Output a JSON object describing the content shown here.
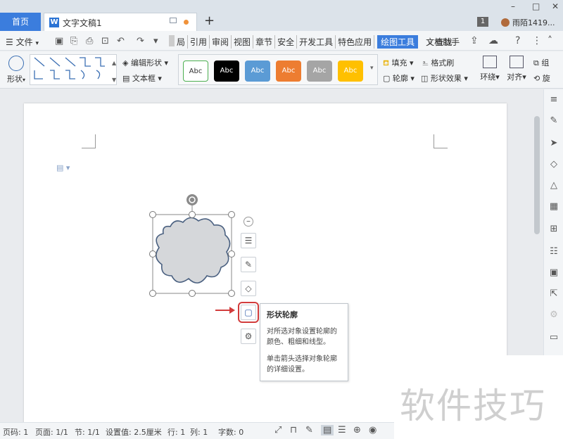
{
  "titlebar": {
    "home_tab": "首页",
    "doc_tab": "文字文稿1",
    "doc_icon": "W",
    "add_tab": "+",
    "notice_count": "1",
    "user_name": "雨陌1419...",
    "min_glyph": "–",
    "max_glyph": "□",
    "close_glyph": "✕"
  },
  "menubar": {
    "file_label": "文件",
    "tabs": [
      "局",
      "引用",
      "审阅",
      "视图",
      "章节",
      "安全",
      "开发工具",
      "特色应用"
    ],
    "active_tab": "绘图工具",
    "extra_tab": "文档助手",
    "search_label": "查找"
  },
  "ribbon": {
    "shape_label": "形状",
    "edit_shape": "编辑形状",
    "textbox": "文本框",
    "style_samples": [
      "Abc",
      "Abc",
      "Abc",
      "Abc",
      "Abc",
      "Abc"
    ],
    "fill": "填充",
    "format_painter": "格式刷",
    "outline": "轮廓",
    "shape_effects": "形状效果",
    "wrap": "环绕",
    "align": "对齐",
    "group": "组",
    "rotate": "旋",
    "style_colors": {
      "white": "#ffffff",
      "black": "#000000",
      "blue": "#5b9bd5",
      "orange": "#ed7d31",
      "gray": "#a5a5a5",
      "gold": "#ffc000"
    }
  },
  "float_toolbar": {
    "collapse": "⊖",
    "layout_icon": "layout-icon",
    "pen_icon": "pen-icon",
    "fill_icon": "fill-icon",
    "outline_icon": "outline-icon",
    "more_icon": "effects-icon",
    "highlight_color": "#d23c3c"
  },
  "tooltip": {
    "title": "形状轮廓",
    "line1": "对所选对象设置轮廓的",
    "line2": "颜色、粗细和线型。",
    "line3": "单击箭头选择对象轮廓",
    "line4": "的详细设置。"
  },
  "shape": {
    "fill": "#d5d7da",
    "stroke": "#4a6080"
  },
  "watermark": "软件技巧",
  "statusbar": {
    "page_num": "页码: 1",
    "page_count": "页面: 1/1",
    "section": "节: 1/1",
    "setting": "设置值: 2.5厘米",
    "row": "行: 1",
    "col": "列: 1",
    "word_count": "字数: 0"
  }
}
